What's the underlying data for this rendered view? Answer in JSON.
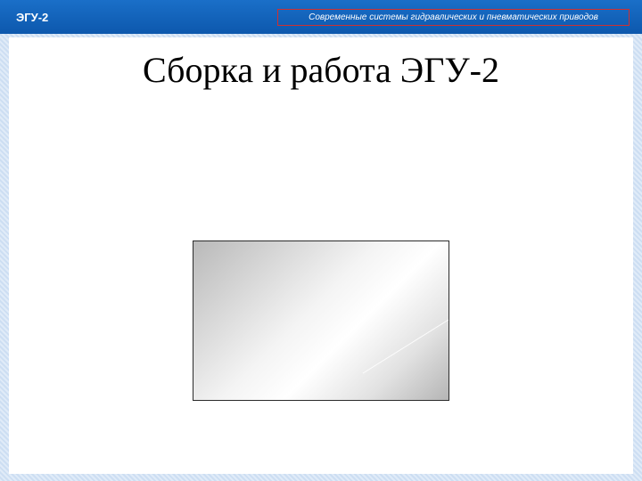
{
  "header": {
    "slide_label": "ЭГУ-2",
    "course_title": "Современные системы гидравлических и пневматических приводов"
  },
  "slide": {
    "title": "Сборка и работа ЭГУ-2"
  },
  "colors": {
    "header_bar": "#0d58ad",
    "course_title_border": "#d1302f",
    "background": "#cfe0f4",
    "panel": "#ffffff"
  }
}
